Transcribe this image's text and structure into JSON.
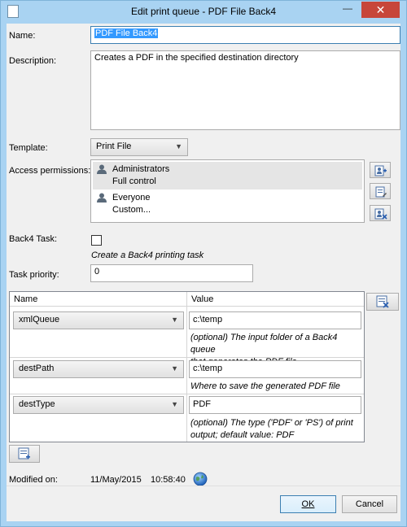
{
  "window": {
    "title": "Edit print queue - PDF File Back4",
    "min_glyph": "—",
    "close_glyph": "✕"
  },
  "form": {
    "name_label": "Name:",
    "name_value": "PDF File Back4",
    "description_label": "Description:",
    "description_value": "Creates a PDF in the specified destination directory",
    "template_label": "Template:",
    "template_value": "Print File",
    "access_label": "Access permissions:",
    "permissions": [
      {
        "name": "Administrators",
        "rights": "Full control",
        "selected": true
      },
      {
        "name": "Everyone",
        "rights": "Custom...",
        "selected": false
      }
    ],
    "back4_label": "Back4 Task:",
    "back4_checked": false,
    "back4_hint": "Create a Back4 printing task",
    "priority_label": "Task priority:",
    "priority_value": "0"
  },
  "grid": {
    "col_name": "Name",
    "col_value": "Value",
    "rows": [
      {
        "name": "xmlQueue",
        "value": "c:\\temp",
        "desc1": "(optional) The input folder of a Back4 queue",
        "desc2": "that generates the PDF file"
      },
      {
        "name": "destPath",
        "value": "c:\\temp",
        "desc1": "Where to save the generated PDF file",
        "desc2": ""
      },
      {
        "name": "destType",
        "value": "PDF",
        "desc1": "(optional) The type ('PDF' or 'PS') of print",
        "desc2": "output; default value: PDF"
      }
    ]
  },
  "modified": {
    "label": "Modified on:",
    "date": "11/May/2015",
    "time": "10:58:40"
  },
  "buttons": {
    "ok": "OK",
    "cancel": "Cancel"
  },
  "icons": {
    "user": "user-icon",
    "add_user": "add-user-icon",
    "edit_user": "edit-user-icon",
    "remove_user": "remove-user-icon",
    "globe": "globe-icon",
    "dropdown": "chevron-down-icon"
  }
}
